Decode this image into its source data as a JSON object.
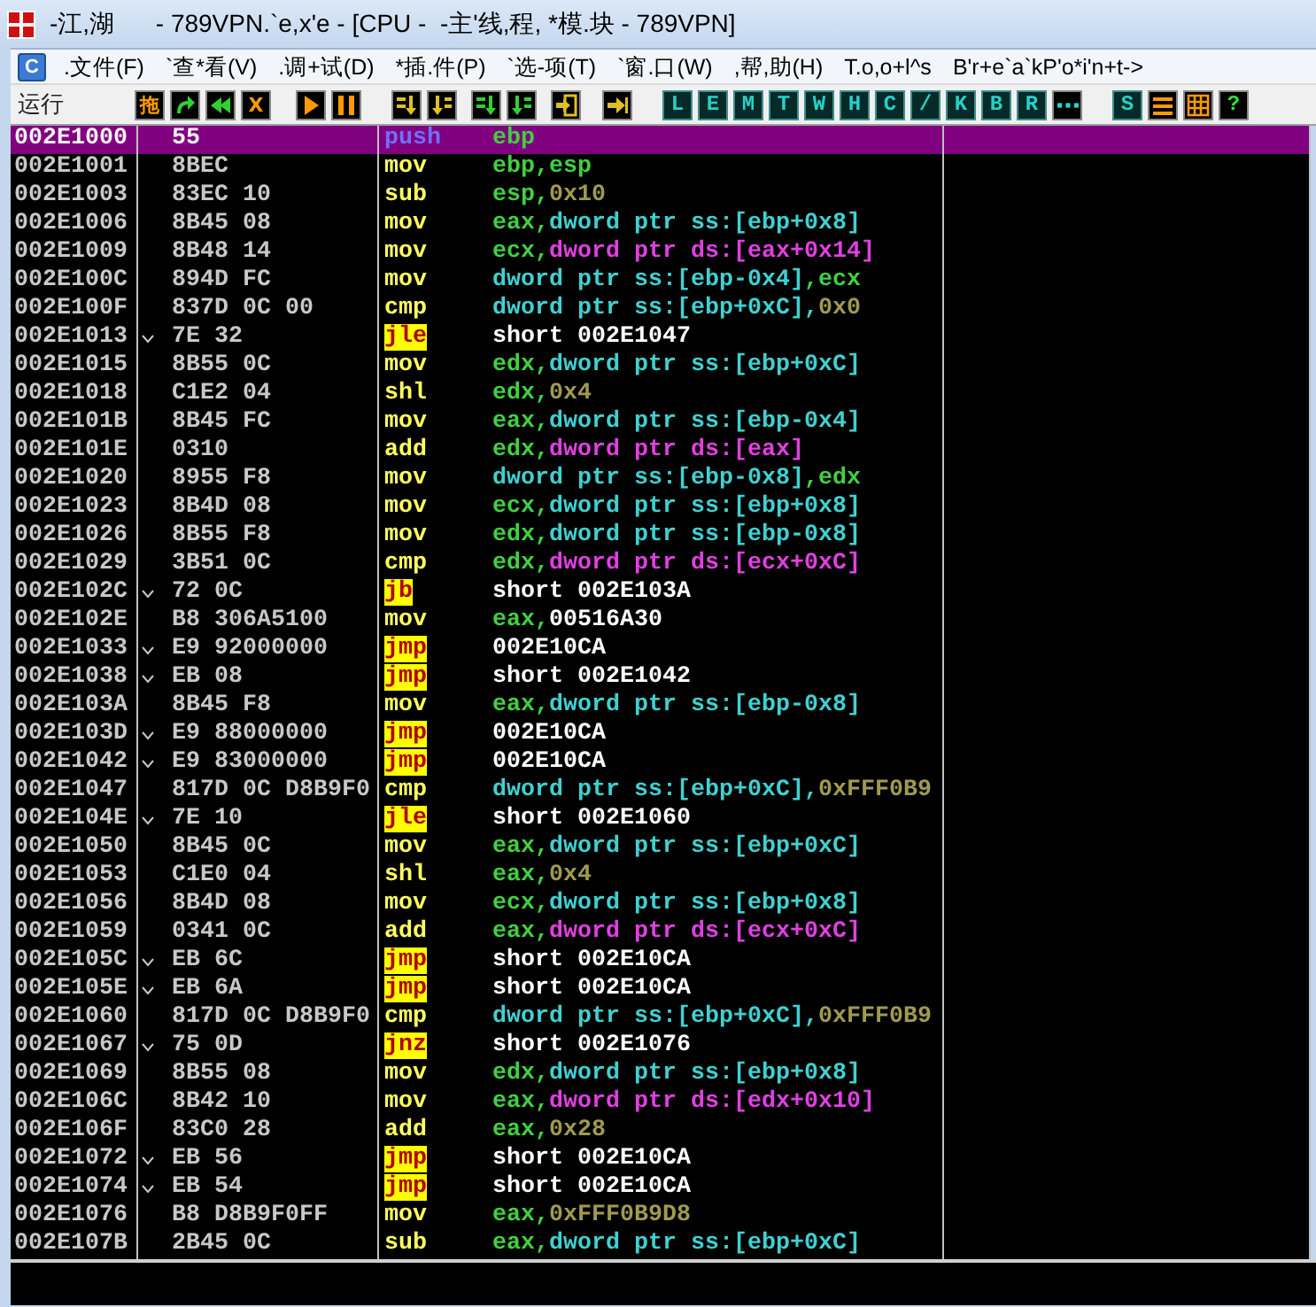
{
  "window": {
    "title": "-江,湖      - 789VPN.`e,x'e - [CPU -  -主'线,程, *模.块 - 789VPN]"
  },
  "menu": {
    "app_letter": "C",
    "items": [
      ".文件(F)",
      "`查*看(V)",
      ".调+试(D)",
      "*插.件(P)",
      "`选-项(T)",
      "`窗.口(W)",
      ",帮,助(H)",
      "T.o,o+l^s",
      "B'r+e`a`kP'o*i'n+t->"
    ]
  },
  "toolbar": {
    "status": "运行",
    "buttons": [
      {
        "kind": "text",
        "label": "拖"
      },
      {
        "kind": "icon"
      },
      {
        "kind": "icon"
      },
      {
        "kind": "text",
        "label": "X"
      },
      {
        "kind": "icon"
      },
      {
        "kind": "icon"
      },
      {
        "kind": "icon"
      },
      {
        "kind": "icon"
      },
      {
        "kind": "icon"
      },
      {
        "kind": "icon"
      },
      {
        "kind": "icon"
      },
      {
        "kind": "icon"
      },
      {
        "kind": "letter",
        "label": "L"
      },
      {
        "kind": "letter",
        "label": "E"
      },
      {
        "kind": "letter",
        "label": "M"
      },
      {
        "kind": "letter",
        "label": "T"
      },
      {
        "kind": "letter",
        "label": "W"
      },
      {
        "kind": "letter",
        "label": "H"
      },
      {
        "kind": "letter",
        "label": "C"
      },
      {
        "kind": "letter",
        "label": "/"
      },
      {
        "kind": "letter",
        "label": "K"
      },
      {
        "kind": "letter",
        "label": "B"
      },
      {
        "kind": "letter",
        "label": "R"
      },
      {
        "kind": "icon"
      },
      {
        "kind": "letter",
        "label": "S"
      },
      {
        "kind": "icon"
      },
      {
        "kind": "icon"
      },
      {
        "kind": "help",
        "label": "?"
      }
    ]
  },
  "rows": [
    {
      "address": "002E1000",
      "hex": "55",
      "jump_mark": false,
      "selected": true,
      "mnemonic": "push",
      "kind": "plain",
      "operands": [
        {
          "text": "ebp",
          "kind": "reg"
        }
      ]
    },
    {
      "address": "002E1001",
      "hex": "8BEC",
      "jump_mark": false,
      "selected": false,
      "mnemonic": "mov",
      "kind": "plain",
      "operands": [
        {
          "text": "ebp,esp",
          "kind": "reg"
        }
      ]
    },
    {
      "address": "002E1003",
      "hex": "83EC 10",
      "jump_mark": false,
      "selected": false,
      "mnemonic": "sub",
      "kind": "plain",
      "operands": [
        {
          "text": "esp,",
          "kind": "reg"
        },
        {
          "text": "0x10",
          "kind": "imm"
        }
      ]
    },
    {
      "address": "002E1006",
      "hex": "8B45 08",
      "jump_mark": false,
      "selected": false,
      "mnemonic": "mov",
      "kind": "plain",
      "operands": [
        {
          "text": "eax,",
          "kind": "reg"
        },
        {
          "text": "dword ptr ss:[ebp+0x8]",
          "kind": "mem"
        }
      ]
    },
    {
      "address": "002E1009",
      "hex": "8B48 14",
      "jump_mark": false,
      "selected": false,
      "mnemonic": "mov",
      "kind": "plain",
      "operands": [
        {
          "text": "ecx,",
          "kind": "reg"
        },
        {
          "text": "dword ptr ds:[eax+0x14]",
          "kind": "ds"
        }
      ]
    },
    {
      "address": "002E100C",
      "hex": "894D FC",
      "jump_mark": false,
      "selected": false,
      "mnemonic": "mov",
      "kind": "plain",
      "operands": [
        {
          "text": "dword ptr ss:[ebp-0x4]",
          "kind": "mem"
        },
        {
          "text": ",ecx",
          "kind": "reg"
        }
      ]
    },
    {
      "address": "002E100F",
      "hex": "837D 0C 00",
      "jump_mark": false,
      "selected": false,
      "mnemonic": "cmp",
      "kind": "plain",
      "operands": [
        {
          "text": "dword ptr ss:[ebp+0xC],",
          "kind": "mem"
        },
        {
          "text": "0x0",
          "kind": "imm"
        }
      ]
    },
    {
      "address": "002E1013",
      "hex": "7E 32",
      "jump_mark": true,
      "selected": false,
      "mnemonic": "jle",
      "kind": "jump",
      "operands": [
        {
          "text": "short 002E1047",
          "kind": "addr"
        }
      ]
    },
    {
      "address": "002E1015",
      "hex": "8B55 0C",
      "jump_mark": false,
      "selected": false,
      "mnemonic": "mov",
      "kind": "plain",
      "operands": [
        {
          "text": "edx,",
          "kind": "reg"
        },
        {
          "text": "dword ptr ss:[ebp+0xC]",
          "kind": "mem"
        }
      ]
    },
    {
      "address": "002E1018",
      "hex": "C1E2 04",
      "jump_mark": false,
      "selected": false,
      "mnemonic": "shl",
      "kind": "plain",
      "operands": [
        {
          "text": "edx,",
          "kind": "reg"
        },
        {
          "text": "0x4",
          "kind": "imm"
        }
      ]
    },
    {
      "address": "002E101B",
      "hex": "8B45 FC",
      "jump_mark": false,
      "selected": false,
      "mnemonic": "mov",
      "kind": "plain",
      "operands": [
        {
          "text": "eax,",
          "kind": "reg"
        },
        {
          "text": "dword ptr ss:[ebp-0x4]",
          "kind": "mem"
        }
      ]
    },
    {
      "address": "002E101E",
      "hex": "0310",
      "jump_mark": false,
      "selected": false,
      "mnemonic": "add",
      "kind": "plain",
      "operands": [
        {
          "text": "edx,",
          "kind": "reg"
        },
        {
          "text": "dword ptr ds:[eax]",
          "kind": "ds"
        }
      ]
    },
    {
      "address": "002E1020",
      "hex": "8955 F8",
      "jump_mark": false,
      "selected": false,
      "mnemonic": "mov",
      "kind": "plain",
      "operands": [
        {
          "text": "dword ptr ss:[ebp-0x8]",
          "kind": "mem"
        },
        {
          "text": ",edx",
          "kind": "reg"
        }
      ]
    },
    {
      "address": "002E1023",
      "hex": "8B4D 08",
      "jump_mark": false,
      "selected": false,
      "mnemonic": "mov",
      "kind": "plain",
      "operands": [
        {
          "text": "ecx,",
          "kind": "reg"
        },
        {
          "text": "dword ptr ss:[ebp+0x8]",
          "kind": "mem"
        }
      ]
    },
    {
      "address": "002E1026",
      "hex": "8B55 F8",
      "jump_mark": false,
      "selected": false,
      "mnemonic": "mov",
      "kind": "plain",
      "operands": [
        {
          "text": "edx,",
          "kind": "reg"
        },
        {
          "text": "dword ptr ss:[ebp-0x8]",
          "kind": "mem"
        }
      ]
    },
    {
      "address": "002E1029",
      "hex": "3B51 0C",
      "jump_mark": false,
      "selected": false,
      "mnemonic": "cmp",
      "kind": "plain",
      "operands": [
        {
          "text": "edx,",
          "kind": "reg"
        },
        {
          "text": "dword ptr ds:[ecx+0xC]",
          "kind": "ds"
        }
      ]
    },
    {
      "address": "002E102C",
      "hex": "72 0C",
      "jump_mark": true,
      "selected": false,
      "mnemonic": "jb",
      "kind": "jump",
      "operands": [
        {
          "text": "short 002E103A",
          "kind": "addr"
        }
      ]
    },
    {
      "address": "002E102E",
      "hex": "B8 306A5100",
      "jump_mark": false,
      "selected": false,
      "mnemonic": "mov",
      "kind": "plain",
      "operands": [
        {
          "text": "eax,",
          "kind": "reg"
        },
        {
          "text": "00516A30",
          "kind": "addr"
        }
      ]
    },
    {
      "address": "002E1033",
      "hex": "E9 92000000",
      "jump_mark": true,
      "selected": false,
      "mnemonic": "jmp",
      "kind": "jump",
      "operands": [
        {
          "text": "002E10CA",
          "kind": "addr"
        }
      ]
    },
    {
      "address": "002E1038",
      "hex": "EB 08",
      "jump_mark": true,
      "selected": false,
      "mnemonic": "jmp",
      "kind": "jump",
      "operands": [
        {
          "text": "short 002E1042",
          "kind": "addr"
        }
      ]
    },
    {
      "address": "002E103A",
      "hex": "8B45 F8",
      "jump_mark": false,
      "selected": false,
      "mnemonic": "mov",
      "kind": "plain",
      "operands": [
        {
          "text": "eax,",
          "kind": "reg"
        },
        {
          "text": "dword ptr ss:[ebp-0x8]",
          "kind": "mem"
        }
      ]
    },
    {
      "address": "002E103D",
      "hex": "E9 88000000",
      "jump_mark": true,
      "selected": false,
      "mnemonic": "jmp",
      "kind": "jump",
      "operands": [
        {
          "text": "002E10CA",
          "kind": "addr"
        }
      ]
    },
    {
      "address": "002E1042",
      "hex": "E9 83000000",
      "jump_mark": true,
      "selected": false,
      "mnemonic": "jmp",
      "kind": "jump",
      "operands": [
        {
          "text": "002E10CA",
          "kind": "addr"
        }
      ]
    },
    {
      "address": "002E1047",
      "hex": "817D 0C D8B9F0",
      "jump_mark": false,
      "selected": false,
      "mnemonic": "cmp",
      "kind": "plain",
      "operands": [
        {
          "text": "dword ptr ss:[ebp+0xC],",
          "kind": "mem"
        },
        {
          "text": "0xFFF0B9",
          "kind": "imm"
        }
      ]
    },
    {
      "address": "002E104E",
      "hex": "7E 10",
      "jump_mark": true,
      "selected": false,
      "mnemonic": "jle",
      "kind": "jump",
      "operands": [
        {
          "text": "short 002E1060",
          "kind": "addr"
        }
      ]
    },
    {
      "address": "002E1050",
      "hex": "8B45 0C",
      "jump_mark": false,
      "selected": false,
      "mnemonic": "mov",
      "kind": "plain",
      "operands": [
        {
          "text": "eax,",
          "kind": "reg"
        },
        {
          "text": "dword ptr ss:[ebp+0xC]",
          "kind": "mem"
        }
      ]
    },
    {
      "address": "002E1053",
      "hex": "C1E0 04",
      "jump_mark": false,
      "selected": false,
      "mnemonic": "shl",
      "kind": "plain",
      "operands": [
        {
          "text": "eax,",
          "kind": "reg"
        },
        {
          "text": "0x4",
          "kind": "imm"
        }
      ]
    },
    {
      "address": "002E1056",
      "hex": "8B4D 08",
      "jump_mark": false,
      "selected": false,
      "mnemonic": "mov",
      "kind": "plain",
      "operands": [
        {
          "text": "ecx,",
          "kind": "reg"
        },
        {
          "text": "dword ptr ss:[ebp+0x8]",
          "kind": "mem"
        }
      ]
    },
    {
      "address": "002E1059",
      "hex": "0341 0C",
      "jump_mark": false,
      "selected": false,
      "mnemonic": "add",
      "kind": "plain",
      "operands": [
        {
          "text": "eax,",
          "kind": "reg"
        },
        {
          "text": "dword ptr ds:[ecx+0xC]",
          "kind": "ds"
        }
      ]
    },
    {
      "address": "002E105C",
      "hex": "EB 6C",
      "jump_mark": true,
      "selected": false,
      "mnemonic": "jmp",
      "kind": "jump",
      "operands": [
        {
          "text": "short 002E10CA",
          "kind": "addr"
        }
      ]
    },
    {
      "address": "002E105E",
      "hex": "EB 6A",
      "jump_mark": true,
      "selected": false,
      "mnemonic": "jmp",
      "kind": "jump",
      "operands": [
        {
          "text": "short 002E10CA",
          "kind": "addr"
        }
      ]
    },
    {
      "address": "002E1060",
      "hex": "817D 0C D8B9F0",
      "jump_mark": false,
      "selected": false,
      "mnemonic": "cmp",
      "kind": "plain",
      "operands": [
        {
          "text": "dword ptr ss:[ebp+0xC],",
          "kind": "mem"
        },
        {
          "text": "0xFFF0B9",
          "kind": "imm"
        }
      ]
    },
    {
      "address": "002E1067",
      "hex": "75 0D",
      "jump_mark": true,
      "selected": false,
      "mnemonic": "jnz",
      "kind": "jump",
      "operands": [
        {
          "text": "short 002E1076",
          "kind": "addr"
        }
      ]
    },
    {
      "address": "002E1069",
      "hex": "8B55 08",
      "jump_mark": false,
      "selected": false,
      "mnemonic": "mov",
      "kind": "plain",
      "operands": [
        {
          "text": "edx,",
          "kind": "reg"
        },
        {
          "text": "dword ptr ss:[ebp+0x8]",
          "kind": "mem"
        }
      ]
    },
    {
      "address": "002E106C",
      "hex": "8B42 10",
      "jump_mark": false,
      "selected": false,
      "mnemonic": "mov",
      "kind": "plain",
      "operands": [
        {
          "text": "eax,",
          "kind": "reg"
        },
        {
          "text": "dword ptr ds:[edx+0x10]",
          "kind": "ds"
        }
      ]
    },
    {
      "address": "002E106F",
      "hex": "83C0 28",
      "jump_mark": false,
      "selected": false,
      "mnemonic": "add",
      "kind": "plain",
      "operands": [
        {
          "text": "eax,",
          "kind": "reg"
        },
        {
          "text": "0x28",
          "kind": "imm"
        }
      ]
    },
    {
      "address": "002E1072",
      "hex": "EB 56",
      "jump_mark": true,
      "selected": false,
      "mnemonic": "jmp",
      "kind": "jump",
      "operands": [
        {
          "text": "short 002E10CA",
          "kind": "addr"
        }
      ]
    },
    {
      "address": "002E1074",
      "hex": "EB 54",
      "jump_mark": true,
      "selected": false,
      "mnemonic": "jmp",
      "kind": "jump",
      "operands": [
        {
          "text": "short 002E10CA",
          "kind": "addr"
        }
      ]
    },
    {
      "address": "002E1076",
      "hex": "B8 D8B9F0FF",
      "jump_mark": false,
      "selected": false,
      "mnemonic": "mov",
      "kind": "plain",
      "operands": [
        {
          "text": "eax,",
          "kind": "reg"
        },
        {
          "text": "0xFFF0B9D8",
          "kind": "imm"
        }
      ]
    },
    {
      "address": "002E107B",
      "hex": "2B45 0C",
      "jump_mark": false,
      "selected": false,
      "mnemonic": "sub",
      "kind": "plain",
      "operands": [
        {
          "text": "eax,",
          "kind": "reg"
        },
        {
          "text": "dword ptr ss:[ebp+0xC]",
          "kind": "mem"
        }
      ]
    }
  ]
}
